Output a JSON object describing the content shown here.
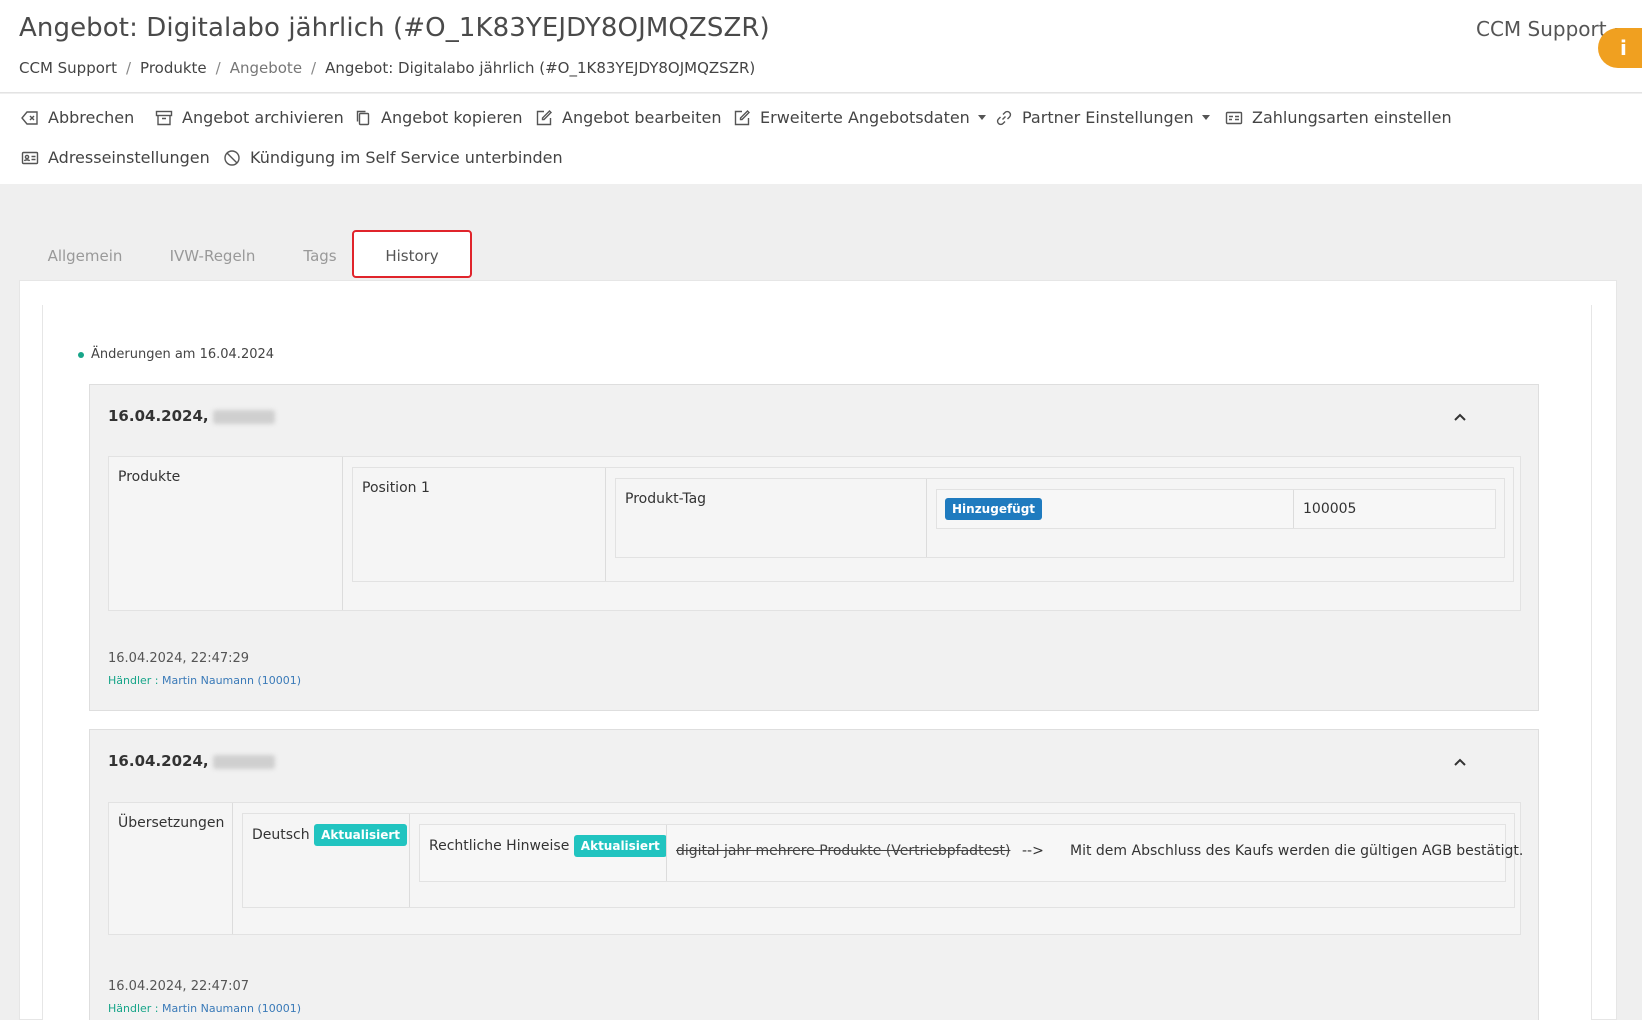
{
  "header": {
    "title": "Angebot: Digitalabo jährlich (#O_1K83YEJDY8OJMQZSZR)",
    "breadcrumb": [
      "CCM Support",
      "Produkte",
      "Angebote",
      "Angebot: Digitalabo jährlich (#O_1K83YEJDY8OJMQZSZR)"
    ],
    "user": "CCM Support",
    "info_icon": "i"
  },
  "toolbar": {
    "items": [
      {
        "label": "Abbrechen",
        "icon": "backspace-icon"
      },
      {
        "label": "Angebot archivieren",
        "icon": "archive-icon"
      },
      {
        "label": "Angebot kopieren",
        "icon": "copy-icon"
      },
      {
        "label": "Angebot bearbeiten",
        "icon": "edit-icon"
      },
      {
        "label": "Erweiterte Angebotsdaten",
        "icon": "edit-icon"
      },
      {
        "label": "Partner Einstellungen",
        "icon": "link-icon"
      },
      {
        "label": "Zahlungsarten einstellen",
        "icon": "card-icon"
      },
      {
        "label": "Adresseinstellungen",
        "icon": "address-card-icon"
      },
      {
        "label": "Kündigung im Self Service unterbinden",
        "icon": "ban-icon"
      }
    ]
  },
  "tabs": [
    "Allgemein",
    "IVW-Regeln",
    "Tags",
    "History"
  ],
  "history": {
    "day_heading": "Änderungen am 16.04.2024",
    "entries": [
      {
        "title": "16.04.2024,",
        "section": "Produkte",
        "position": "Position 1",
        "field": "Produkt-Tag",
        "badge": "Hinzugefügt",
        "value": "100005",
        "footer_time": "16.04.2024, 22:47:29",
        "footer_label": "Händler :",
        "footer_user": "Martin Naumann (10001)"
      },
      {
        "title": "16.04.2024,",
        "section": "Übersetzungen",
        "language": "Deutsch",
        "language_badge": "Aktualisiert",
        "field": "Rechtliche Hinweise",
        "field_badge": "Aktualisiert",
        "old_value": "digital jahr mehrere Produkte (Vertriebpfadtest)",
        "arrow": "-->",
        "new_value": "Mit dem Abschluss des Kaufs werden die gültigen AGB bestätigt.",
        "footer_time": "16.04.2024, 22:47:07",
        "footer_label": "Händler :",
        "footer_user": "Martin Naumann (10001)"
      }
    ]
  },
  "colors": {
    "accent_orange": "#f0a020",
    "tab_highlight": "#e0242b",
    "badge_blue": "#1f7bbf",
    "badge_teal": "#21c4c0",
    "green": "#17a589"
  }
}
